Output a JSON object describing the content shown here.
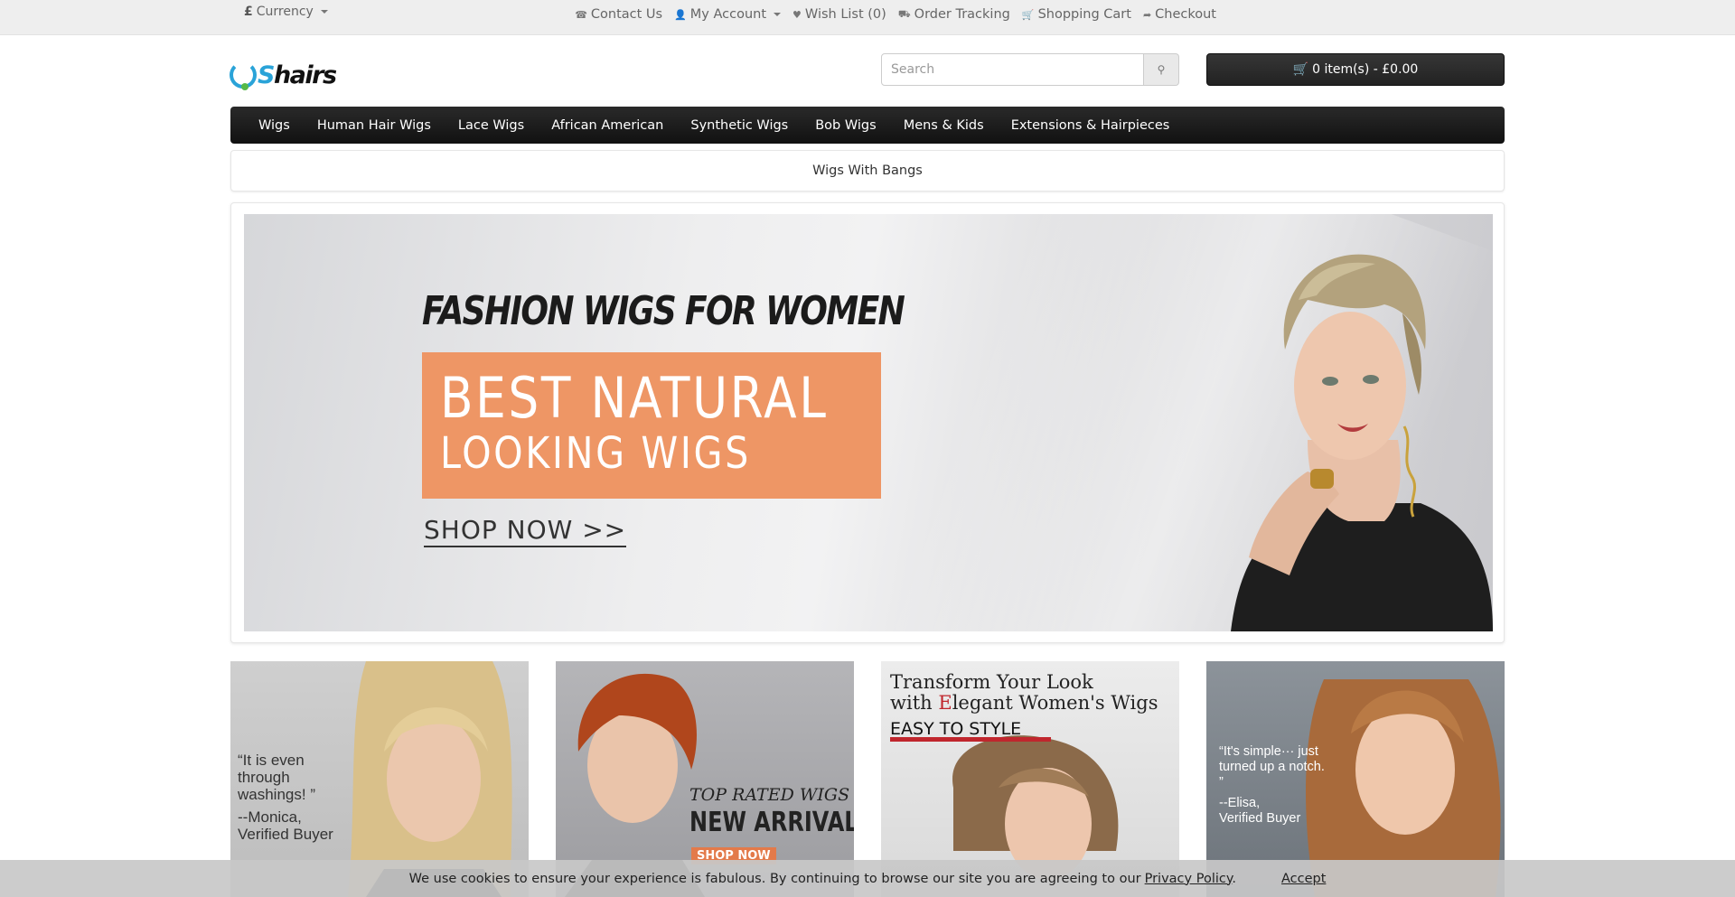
{
  "topbar": {
    "currency_symbol": "£",
    "currency_label": "Currency",
    "links": [
      {
        "icon": "phone-icon",
        "glyph": "☎",
        "label": "Contact Us"
      },
      {
        "icon": "user-icon",
        "glyph": "👤",
        "label": "My Account"
      },
      {
        "icon": "heart-icon",
        "glyph": "♥",
        "label": "Wish List (0)"
      },
      {
        "icon": "truck-icon",
        "glyph": "⛟",
        "label": "Order Tracking"
      },
      {
        "icon": "cart-icon",
        "glyph": "🛒",
        "label": "Shopping Cart"
      },
      {
        "icon": "share-icon",
        "glyph": "➦",
        "label": "Checkout"
      }
    ]
  },
  "header": {
    "logo_u": "U",
    "logo_s": "S",
    "logo_rest": "hairs",
    "search_placeholder": "Search",
    "cart_label": "0 item(s) - £0.00"
  },
  "menu": {
    "items": [
      "Wigs",
      "Human Hair Wigs",
      "Lace Wigs",
      "African American",
      "Synthetic Wigs",
      "Bob Wigs",
      "Mens & Kids",
      "Extensions & Hairpieces"
    ],
    "subcategory": "Wigs With Bangs"
  },
  "hero": {
    "title": "FASHION WIGS FOR WOMEN",
    "line1": "BEST NATURAL",
    "line2": "LOOKING WIGS",
    "cta": "SHOP NOW >>"
  },
  "tiles": {
    "t1": {
      "quote": "“It is even through washings! ”",
      "who": "--Monica,",
      "who2": "Verified Buyer"
    },
    "t2": {
      "tag": "TOP RATED WIGS",
      "headline": "NEW ARRIVAL",
      "cta": "SHOP NOW"
    },
    "t3": {
      "line1": "Transform Your Look",
      "line2_pre": "with ",
      "line2_e": "E",
      "line2_post": "legant Women's Wigs",
      "sub": "EASY TO STYLE"
    },
    "t4": {
      "quote": "“It's simple··· just turned up a notch. ”",
      "who": "--Elisa,",
      "who2": "Verified Buyer"
    }
  },
  "cookie": {
    "text": "We use cookies to ensure your experience is fabulous. By continuing to browse our site you are agreeing to our",
    "policy": "Privacy Policy",
    "period": ".",
    "accept": "Accept"
  },
  "colors": {
    "accent_orange": "#ee9665",
    "logo_blue": "#2aa3d8",
    "logo_green": "#56b947"
  }
}
